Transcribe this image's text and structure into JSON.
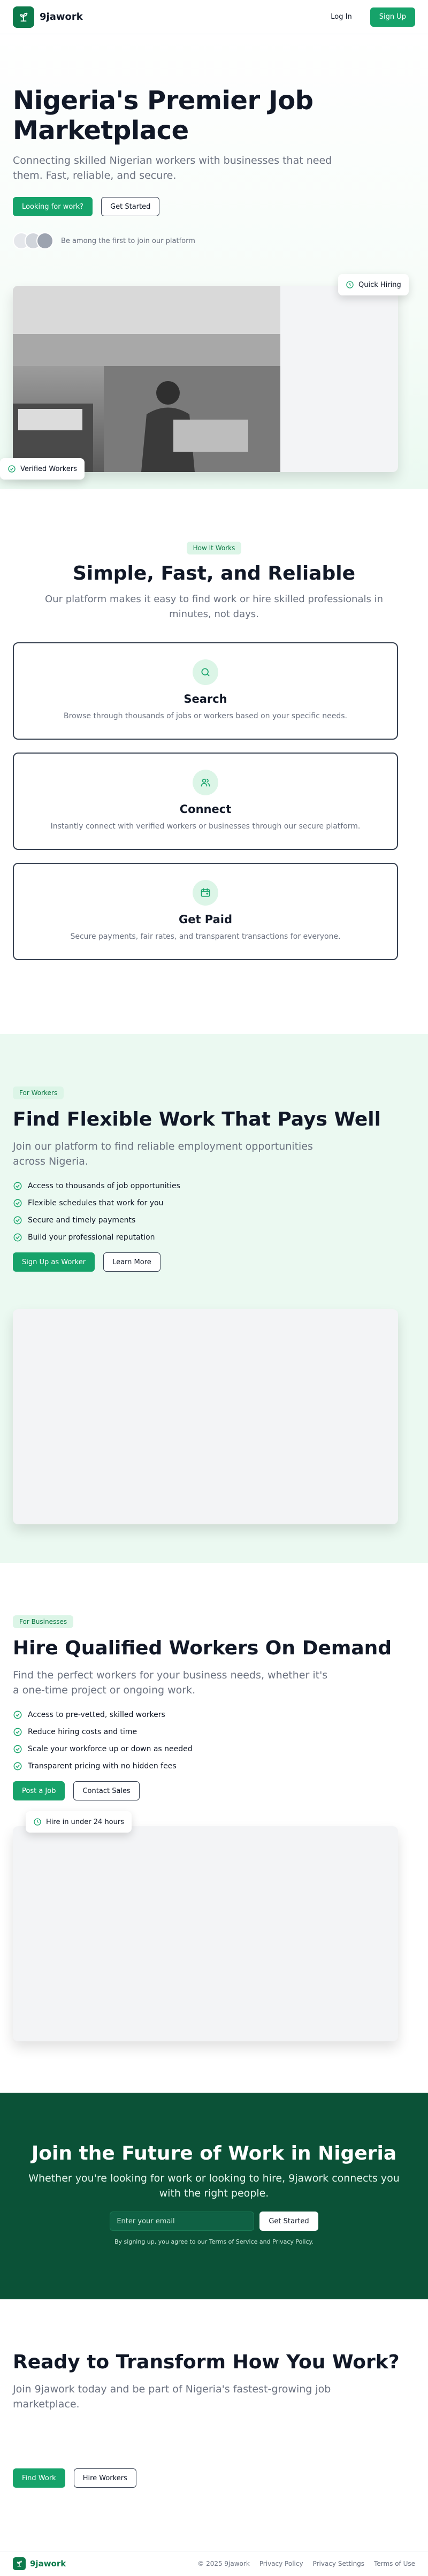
{
  "brand": {
    "name": "9jawork",
    "accent": "#16a36a",
    "dark_green": "#0b5237"
  },
  "nav": {
    "login_label": "Log In",
    "signup_label": "Sign Up"
  },
  "hero": {
    "title": "Nigeria's Premier Job Marketplace",
    "subtitle": "Connecting skilled Nigerian workers with businesses that need them. Fast, reliable, and secure.",
    "primary_cta": "Looking for work?",
    "secondary_cta": "Get Started",
    "social_proof": "Be among the first to join our platform",
    "badge_quick": "Quick Hiring",
    "badge_verified": "Verified Workers"
  },
  "how": {
    "pill": "How It Works",
    "title": "Simple, Fast, and Reliable",
    "subtitle": "Our platform makes it easy to find work or hire skilled professionals in minutes, not days.",
    "steps": [
      {
        "icon": "search-icon",
        "title": "Search",
        "desc": "Browse through thousands of jobs or workers based on your specific needs."
      },
      {
        "icon": "users-icon",
        "title": "Connect",
        "desc": "Instantly connect with verified workers or businesses through our secure platform."
      },
      {
        "icon": "wallet-icon",
        "title": "Get Paid",
        "desc": "Secure payments, fair rates, and transparent transactions for everyone."
      }
    ]
  },
  "workers": {
    "pill": "For Workers",
    "title": "Find Flexible Work That Pays Well",
    "subtitle": "Join our platform to find reliable employment opportunities across Nigeria.",
    "items": [
      "Access to thousands of job opportunities",
      "Flexible schedules that work for you",
      "Secure and timely payments",
      "Build your professional reputation"
    ],
    "primary_cta": "Sign Up as Worker",
    "secondary_cta": "Learn More"
  },
  "business": {
    "pill": "For Businesses",
    "title": "Hire Qualified Workers On Demand",
    "subtitle": "Find the perfect workers for your business needs, whether it's a one-time project or ongoing work.",
    "items": [
      "Access to pre-vetted, skilled workers",
      "Reduce hiring costs and time",
      "Scale your workforce up or down as needed",
      "Transparent pricing with no hidden fees"
    ],
    "primary_cta": "Post a Job",
    "secondary_cta": "Contact Sales",
    "badge": "Hire in under 24 hours"
  },
  "join": {
    "title": "Join the Future of Work in Nigeria",
    "subtitle": "Whether you're looking for work or looking to hire, 9jawork connects you with the right people.",
    "email_placeholder": "Enter your email",
    "cta": "Get Started",
    "note": "By signing up, you agree to our Terms of Service and Privacy Policy."
  },
  "ready": {
    "title": "Ready to Transform How You Work?",
    "subtitle": "Join 9jawork today and be part of Nigeria's fastest-growing job marketplace.",
    "primary_cta": "Find Work",
    "secondary_cta": "Hire Workers"
  },
  "footer": {
    "copyright": "© 2025 9jawork",
    "links": [
      "Privacy Policy",
      "Privacy Settings",
      "Terms of Use"
    ]
  }
}
